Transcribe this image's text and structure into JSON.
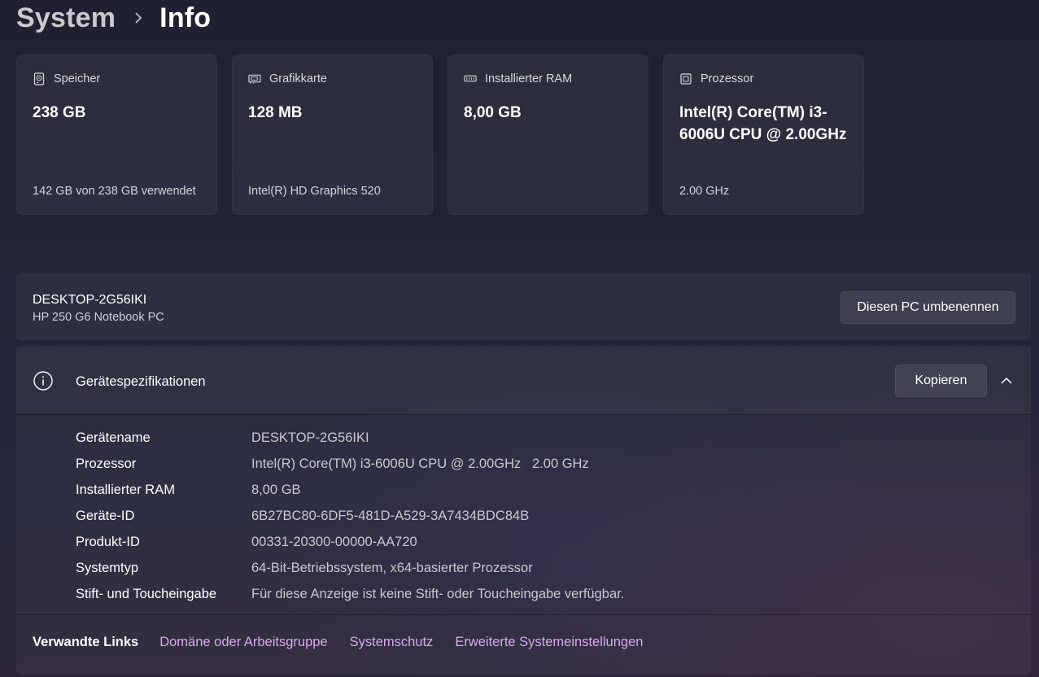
{
  "breadcrumb": {
    "parent": "System",
    "current": "Info"
  },
  "cards": [
    {
      "icon": "storage-drive-icon",
      "title": "Speicher",
      "value": "238 GB",
      "sub": "142 GB von 238 GB verwendet"
    },
    {
      "icon": "graphics-card-icon",
      "title": "Grafikkarte",
      "value": "128 MB",
      "sub": "Intel(R) HD Graphics 520"
    },
    {
      "icon": "ram-module-icon",
      "title": "Installierter RAM",
      "value": "8,00 GB",
      "sub": ""
    },
    {
      "icon": "processor-chip-icon",
      "title": "Prozessor",
      "value": "Intel(R) Core(TM) i3-6006U CPU @ 2.00GHz",
      "sub": "2.00 GHz"
    }
  ],
  "pc": {
    "name": "DESKTOP-2G56IKI",
    "model": "HP 250 G6 Notebook PC",
    "rename_button": "Diesen PC umbenennen"
  },
  "specs": {
    "title": "Gerätespezifikationen",
    "copy_button": "Kopieren",
    "rows": [
      {
        "label": "Gerätename",
        "value": "DESKTOP-2G56IKI"
      },
      {
        "label": "Prozessor",
        "value": "Intel(R) Core(TM) i3-6006U CPU @ 2.00GHz   2.00 GHz"
      },
      {
        "label": "Installierter RAM",
        "value": "8,00 GB"
      },
      {
        "label": "Geräte-ID",
        "value": "6B27BC80-6DF5-481D-A529-3A7434BDC84B"
      },
      {
        "label": "Produkt-ID",
        "value": "00331-20300-00000-AA720"
      },
      {
        "label": "Systemtyp",
        "value": "64-Bit-Betriebssystem, x64-basierter Prozessor"
      },
      {
        "label": "Stift- und Toucheingabe",
        "value": "Für diese Anzeige ist keine Stift- oder Toucheingabe verfügbar."
      }
    ]
  },
  "related": {
    "label": "Verwandte Links",
    "links": [
      "Domäne oder Arbeitsgruppe",
      "Systemschutz",
      "Erweiterte Systemeinstellungen"
    ]
  },
  "colors": {
    "link": "#d7a9ee",
    "card_bg": "#2a2c3b",
    "text_secondary": "#c8c8ce"
  }
}
